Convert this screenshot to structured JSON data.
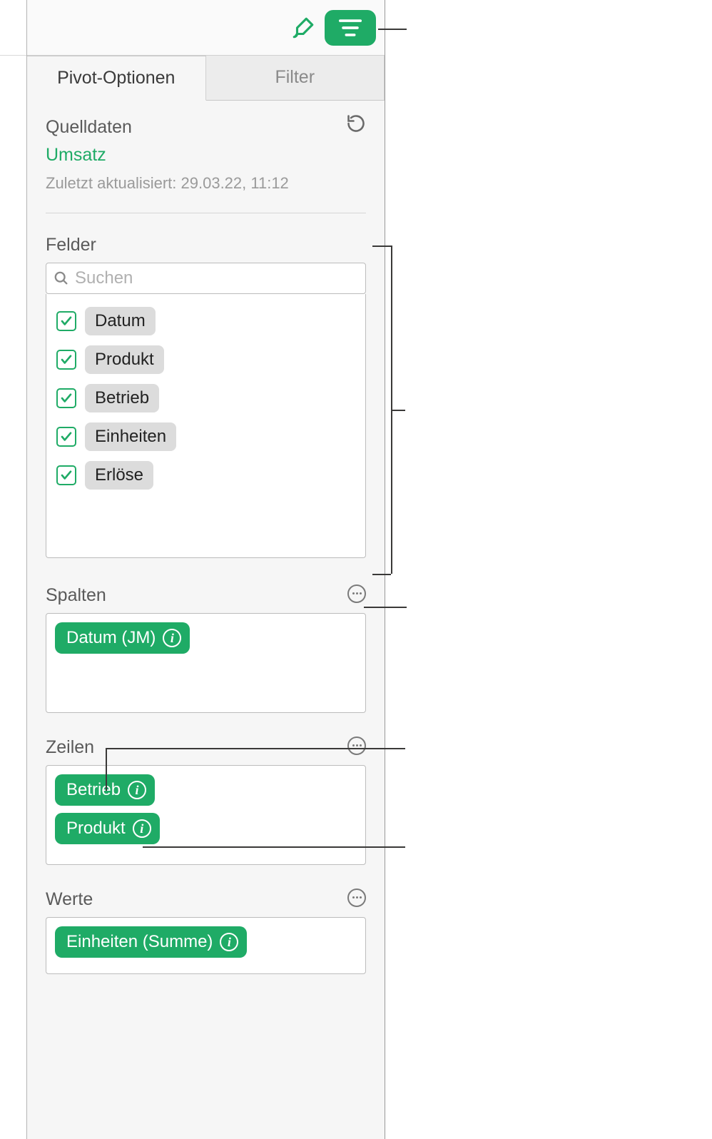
{
  "toolbar": {
    "format_icon": "paintbrush-icon",
    "organize_icon": "lines-icon"
  },
  "tabs": {
    "pivot": "Pivot-Optionen",
    "filter": "Filter"
  },
  "source": {
    "heading": "Quelldaten",
    "table_link": "Umsatz",
    "updated": "Zuletzt aktualisiert: 29.03.22, 11:12"
  },
  "fields": {
    "heading": "Felder",
    "search_placeholder": "Suchen",
    "items": [
      {
        "label": "Datum",
        "checked": true
      },
      {
        "label": "Produkt",
        "checked": true
      },
      {
        "label": "Betrieb",
        "checked": true
      },
      {
        "label": "Einheiten",
        "checked": true
      },
      {
        "label": "Erlöse",
        "checked": true
      }
    ]
  },
  "columns": {
    "heading": "Spalten",
    "items": [
      {
        "label": "Datum (JM)"
      }
    ]
  },
  "rows": {
    "heading": "Zeilen",
    "items": [
      {
        "label": "Betrieb"
      },
      {
        "label": "Produkt"
      }
    ]
  },
  "values": {
    "heading": "Werte",
    "items": [
      {
        "label": "Einheiten (Summe)"
      }
    ]
  }
}
